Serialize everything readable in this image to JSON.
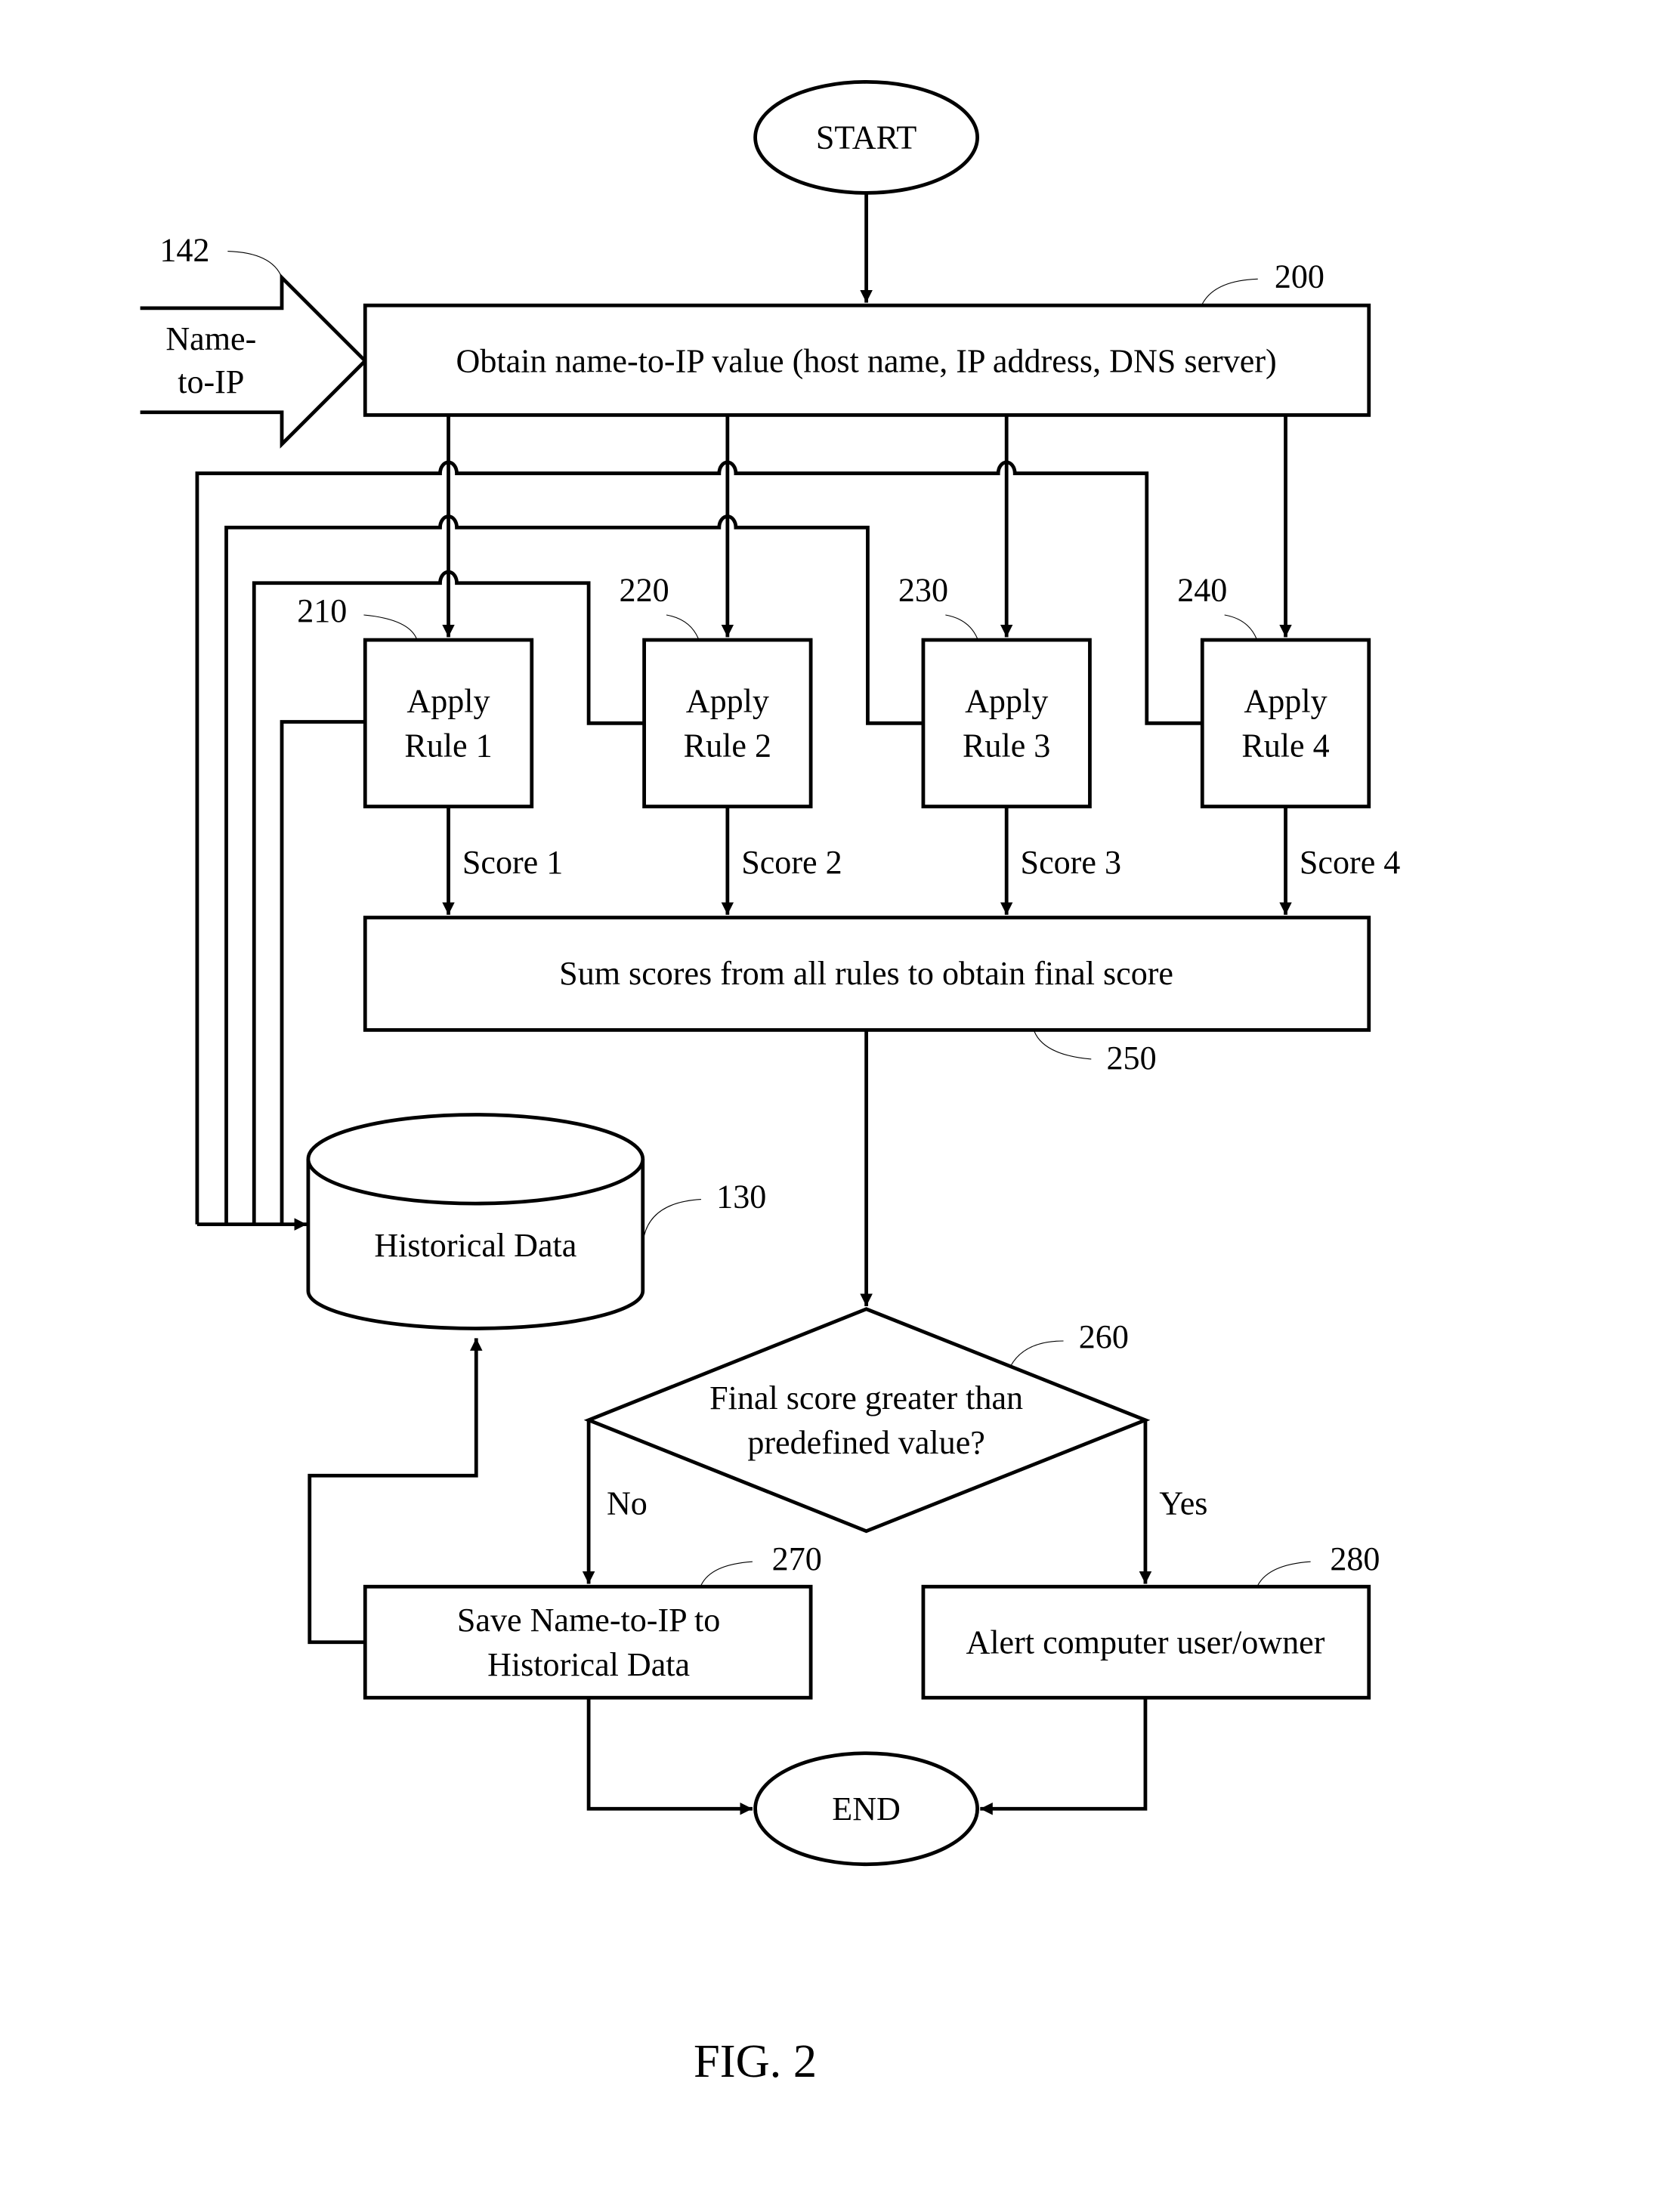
{
  "figure": {
    "caption": "FIG. 2"
  },
  "nodes": {
    "start": {
      "label": "START"
    },
    "end": {
      "label": "END"
    },
    "input": {
      "ref": "142",
      "line1": "Name-",
      "line2": "to-IP"
    },
    "obtain": {
      "ref": "200",
      "label": "Obtain name-to-IP value (host name, IP address, DNS server)"
    },
    "rules": [
      {
        "ref": "210",
        "line1": "Apply",
        "line2": "Rule 1",
        "score": "Score 1"
      },
      {
        "ref": "220",
        "line1": "Apply",
        "line2": "Rule 2",
        "score": "Score 2"
      },
      {
        "ref": "230",
        "line1": "Apply",
        "line2": "Rule 3",
        "score": "Score 3"
      },
      {
        "ref": "240",
        "line1": "Apply",
        "line2": "Rule 4",
        "score": "Score 4"
      }
    ],
    "sum": {
      "ref": "250",
      "label": "Sum scores from all rules to obtain final score"
    },
    "historical": {
      "ref": "130",
      "label": "Historical Data"
    },
    "decision": {
      "ref": "260",
      "line1": "Final score greater than",
      "line2": "predefined value?",
      "no_label": "No",
      "yes_label": "Yes"
    },
    "save": {
      "ref": "270",
      "line1": "Save Name-to-IP to",
      "line2": "Historical Data"
    },
    "alert": {
      "ref": "280",
      "label": "Alert computer user/owner"
    }
  }
}
